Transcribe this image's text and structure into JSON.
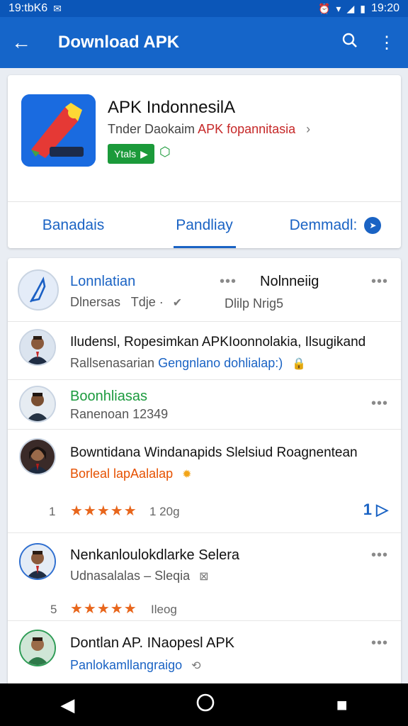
{
  "status_bar": {
    "time_left": "19:tbK6",
    "time_right": "19:20"
  },
  "app_bar": {
    "title": "Download APK"
  },
  "app": {
    "name": "APK IndonnesilA",
    "sub_prefix": "Tnder Daokaim",
    "sub_highlight": "APK fopannitasia",
    "badge_label": "Ytals"
  },
  "tabs": [
    {
      "label": "Banadais"
    },
    {
      "label": "Pandliay"
    },
    {
      "label": "Demmadl:"
    }
  ],
  "rows": [
    {
      "title": "Lonnlatian",
      "sub": "Dlnersas",
      "sub2": "Tdje ·",
      "col2_title": "Nolnneiig",
      "col2_sub": "Dlilp  Nrig5"
    },
    {
      "title": "Iludensl, Ropesimkan APKIoonnolakia, Ilsugikand",
      "sub_prefix": "Rallsenasarian",
      "sub_highlight": "Gengnlano dohlialap:)"
    },
    {
      "title": "Boonhliasas",
      "sub": "Ranenoan 12349"
    },
    {
      "title": "Bowntidana Windanapids Slelsiud Roagnentean",
      "sub": "Borleal lapAalalap",
      "stars_num": "1",
      "rating_label": "1 20g",
      "page_label": "1"
    },
    {
      "title": "Nenkanloulokdlarke Selera",
      "sub": "Udnasalalas – Sleqia",
      "stars_num": "5",
      "rating_label": "Ileog"
    },
    {
      "title": "Dontlan AP. INaopesl APK",
      "sub": "Panlokamllangraigo"
    }
  ]
}
